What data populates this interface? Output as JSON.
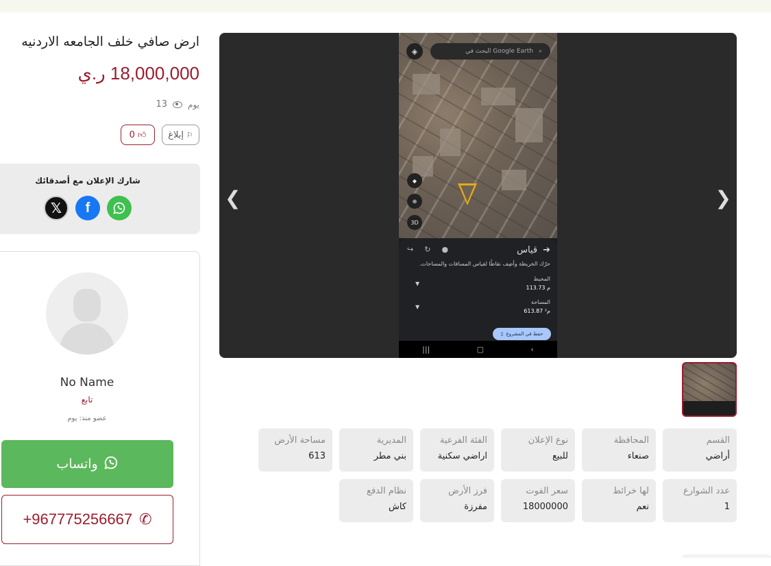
{
  "listing": {
    "title": "ارض صافي خلف الجامعه الاردنيه",
    "price": "18,000,000 ر.ي",
    "posted": "يوم",
    "views": "13",
    "report_label": "إبلاغ",
    "likes": "0"
  },
  "share": {
    "title": "شارك الإعلان مع أصدقائك",
    "icons": [
      "x-icon",
      "facebook-icon",
      "whatsapp-icon"
    ]
  },
  "seller": {
    "name": "No Name",
    "role": "تابع",
    "member_since": "عضو منذ: يوم",
    "whatsapp_label": "واتساب",
    "phone": "+967775256667"
  },
  "gallery": {
    "screen": {
      "search_placeholder": "البحث في Google Earth",
      "btn_3d": "3D",
      "sheet_title": "قياس",
      "sheet_hint": "حرّك الخريطة وأضِف نقاطًا لقياس المسافات والمساحات.",
      "perimeter_label": "المحيط",
      "perimeter_value": "113.73 م",
      "area_label": "المساحة",
      "area_value": "613.87 م²",
      "save_label": "حفظ في المشروع"
    }
  },
  "specs": [
    {
      "label": "القسم",
      "value": "أراضي"
    },
    {
      "label": "المحافظة",
      "value": "صنعاء"
    },
    {
      "label": "نوع الإعلان",
      "value": "للبيع"
    },
    {
      "label": "الفئة الفرعية",
      "value": "اراضي سكنية"
    },
    {
      "label": "المديرية",
      "value": "بني مطر"
    },
    {
      "label": "مساحة الأرض",
      "value": "613"
    },
    {
      "label": "عدد الشوارع",
      "value": "1"
    },
    {
      "label": "لها خرائط",
      "value": "نعم"
    },
    {
      "label": "سعر الفوت",
      "value": "18000000"
    },
    {
      "label": "فرز الأرض",
      "value": "مفرزة"
    },
    {
      "label": "نظام الدفع",
      "value": "كاش"
    }
  ],
  "colors": {
    "accent": "#9b1c2e",
    "whatsapp": "#5cb85c",
    "facebook": "#1877f2",
    "card_bg": "#ececec"
  }
}
